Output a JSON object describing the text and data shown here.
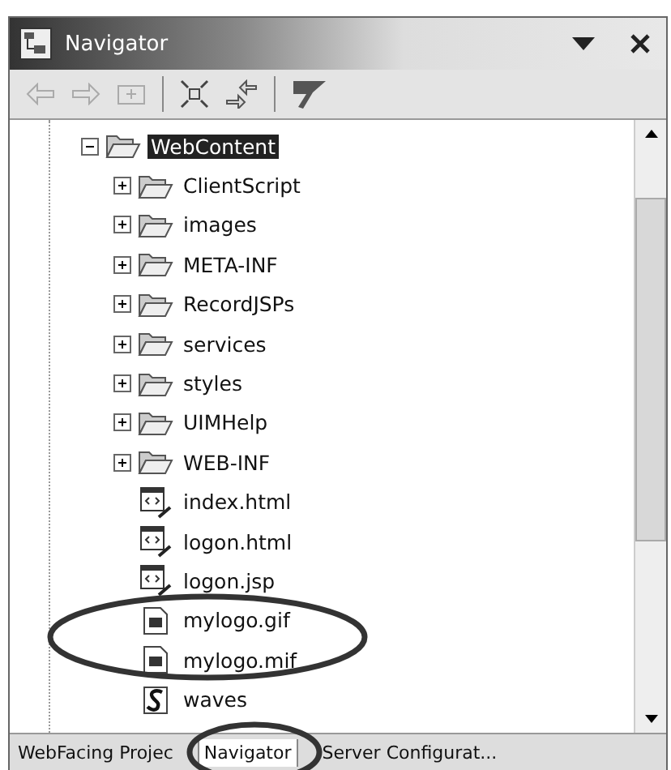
{
  "window": {
    "title": "Navigator"
  },
  "tree": {
    "label": "WebContent",
    "kind": "folder",
    "expanded": true,
    "selected": true,
    "children": [
      {
        "label": "ClientScript",
        "kind": "folder",
        "expanded": false,
        "selected": false
      },
      {
        "label": "images",
        "kind": "folder",
        "expanded": false,
        "selected": false
      },
      {
        "label": "META-INF",
        "kind": "folder",
        "expanded": false,
        "selected": false
      },
      {
        "label": "RecordJSPs",
        "kind": "folder",
        "expanded": false,
        "selected": false
      },
      {
        "label": "services",
        "kind": "folder",
        "expanded": false,
        "selected": false
      },
      {
        "label": "styles",
        "kind": "folder",
        "expanded": false,
        "selected": false
      },
      {
        "label": "UIMHelp",
        "kind": "folder",
        "expanded": false,
        "selected": false
      },
      {
        "label": "WEB-INF",
        "kind": "folder",
        "expanded": false,
        "selected": false
      },
      {
        "label": "index.html",
        "kind": "web",
        "selected": false
      },
      {
        "label": "logon.html",
        "kind": "web",
        "selected": false
      },
      {
        "label": "logon.jsp",
        "kind": "web",
        "selected": false
      },
      {
        "label": "mylogo.gif",
        "kind": "image",
        "selected": false
      },
      {
        "label": "mylogo.mif",
        "kind": "image",
        "selected": false
      },
      {
        "label": "waves",
        "kind": "style",
        "selected": false
      }
    ]
  },
  "tabs": [
    {
      "label": "WebFacing Projec",
      "selected": false
    },
    {
      "label": "Navigator",
      "selected": true
    },
    {
      "label": "Server Configurat...",
      "selected": false
    }
  ]
}
